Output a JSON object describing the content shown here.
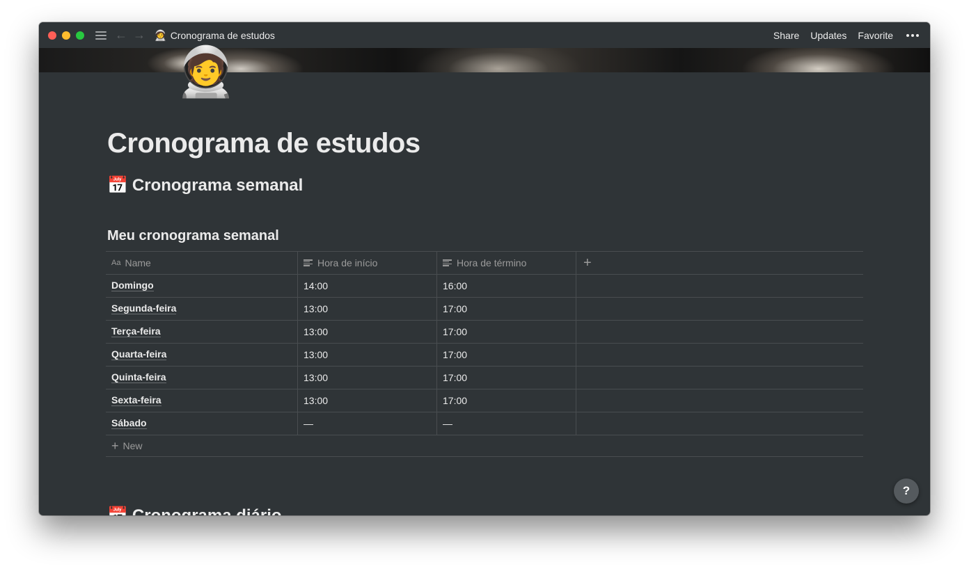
{
  "titlebar": {
    "page_emoji": "🧑‍🚀",
    "page_title": "Cronograma de estudos",
    "share": "Share",
    "updates": "Updates",
    "favorite": "Favorite"
  },
  "page": {
    "icon": "🧑‍🚀",
    "title": "Cronograma de estudos",
    "heading_emoji": "📅",
    "heading": "Cronograma semanal",
    "next_heading_emoji": "📅",
    "next_heading": "Cronograma diário"
  },
  "database": {
    "title": "Meu cronograma semanal",
    "columns": [
      {
        "icon": "Aa",
        "label": "Name"
      },
      {
        "icon": "text-lines-icon",
        "label": "Hora de início"
      },
      {
        "icon": "text-lines-icon",
        "label": "Hora de término"
      }
    ],
    "rows": [
      {
        "name": "Domingo",
        "start": "14:00",
        "end": "16:00"
      },
      {
        "name": "Segunda-feira",
        "start": "13:00",
        "end": "17:00"
      },
      {
        "name": "Terça-feira",
        "start": "13:00",
        "end": "17:00"
      },
      {
        "name": "Quarta-feira",
        "start": "13:00",
        "end": "17:00"
      },
      {
        "name": "Quinta-feira",
        "start": "13:00",
        "end": "17:00"
      },
      {
        "name": "Sexta-feira",
        "start": "13:00",
        "end": "17:00"
      },
      {
        "name": "Sábado",
        "start": "—",
        "end": "—"
      }
    ],
    "add_column_symbol": "+",
    "new_label": "New"
  },
  "help": {
    "label": "?"
  },
  "colors": {
    "background": "#2f3437",
    "text": "#ebebeb",
    "muted": "#9b9b9b",
    "border": "#494d50"
  }
}
